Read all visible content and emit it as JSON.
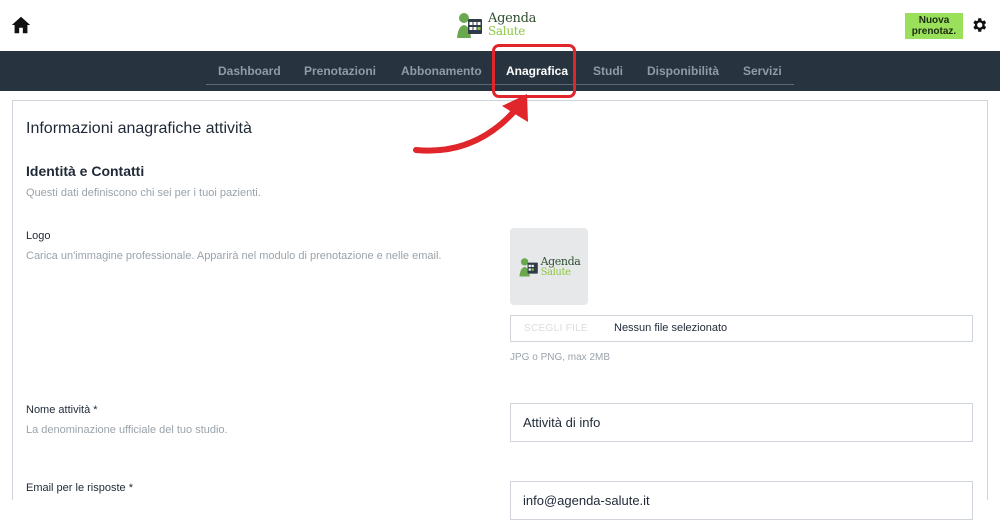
{
  "header": {
    "logo_line1": "Agenda",
    "logo_line2": "Salute",
    "new_booking_label": "Nuova prenotaz."
  },
  "nav": {
    "items": [
      {
        "label": "Dashboard"
      },
      {
        "label": "Prenotazioni"
      },
      {
        "label": "Abbonamento"
      },
      {
        "label": "Anagrafica"
      },
      {
        "label": "Studi"
      },
      {
        "label": "Disponibilità"
      },
      {
        "label": "Servizi"
      }
    ],
    "active": "Anagrafica"
  },
  "page": {
    "title": "Informazioni anagrafiche attività",
    "section_title": "Identità e Contatti",
    "section_desc": "Questi dati definiscono chi sei per i tuoi pazienti."
  },
  "fields": {
    "logo": {
      "label": "Logo",
      "desc": "Carica un'immagine professionale. Apparirà nel modulo di prenotazione e nelle email.",
      "preview_line1": "Agenda",
      "preview_line2": "Salute",
      "file_button": "SCEGLI FILE",
      "file_status": "Nessun file selezionato",
      "hint": "JPG o PNG, max 2MB"
    },
    "name": {
      "label": "Nome attività *",
      "desc": "La denominazione ufficiale del tuo studio.",
      "value": "Attività di info"
    },
    "email": {
      "label": "Email per le risposte *",
      "value": "info@agenda-salute.it"
    }
  },
  "colors": {
    "navbar_bg": "#27343f",
    "accent_green": "#9be05b",
    "highlight_red": "#e0262b"
  }
}
